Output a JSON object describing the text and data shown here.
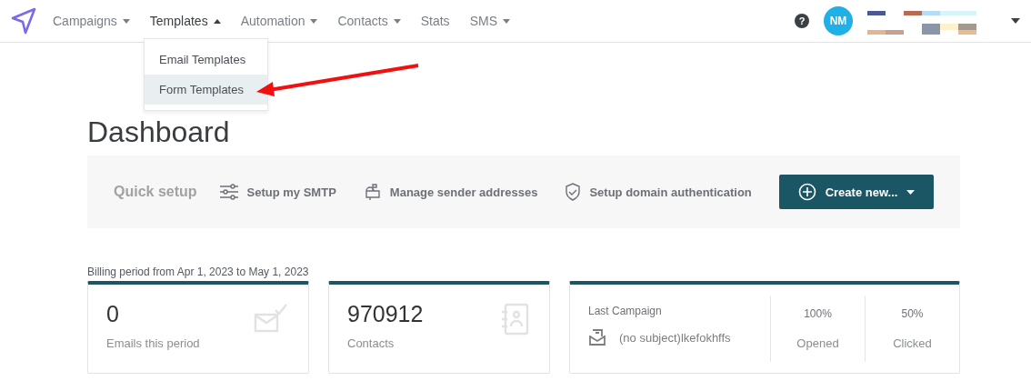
{
  "nav": [
    {
      "label": "Campaigns",
      "dropdown": true,
      "expanded": false
    },
    {
      "label": "Templates",
      "dropdown": true,
      "expanded": true
    },
    {
      "label": "Automation",
      "dropdown": true,
      "expanded": false
    },
    {
      "label": "Contacts",
      "dropdown": true,
      "expanded": false
    },
    {
      "label": "Stats",
      "dropdown": false,
      "expanded": false
    },
    {
      "label": "SMS",
      "dropdown": true,
      "expanded": false
    }
  ],
  "menu": [
    {
      "label": "Email Templates",
      "selected": false
    },
    {
      "label": "Form Templates",
      "selected": true
    }
  ],
  "help": "?",
  "avatar": "NM",
  "title": "Dashboard",
  "quick_setup": {
    "label": "Quick setup",
    "actions": [
      {
        "kind": "smtp",
        "label": "Setup my SMTP"
      },
      {
        "kind": "sender",
        "label": "Manage sender addresses"
      },
      {
        "kind": "domain",
        "label": "Setup domain authentication"
      }
    ],
    "button": "Create new..."
  },
  "billing": "Billing period from Apr 1, 2023 to May 1, 2023",
  "stats": [
    {
      "kind": "emails",
      "value": "0",
      "label": "Emails this period"
    },
    {
      "kind": "contacts",
      "value": "970912",
      "label": "Contacts"
    }
  ],
  "last_campaign": {
    "label": "Last Campaign",
    "subject": "(no subject)lkefokhffs",
    "metrics": [
      {
        "value": "100%",
        "label": "Opened"
      },
      {
        "value": "50%",
        "label": "Clicked"
      }
    ]
  }
}
